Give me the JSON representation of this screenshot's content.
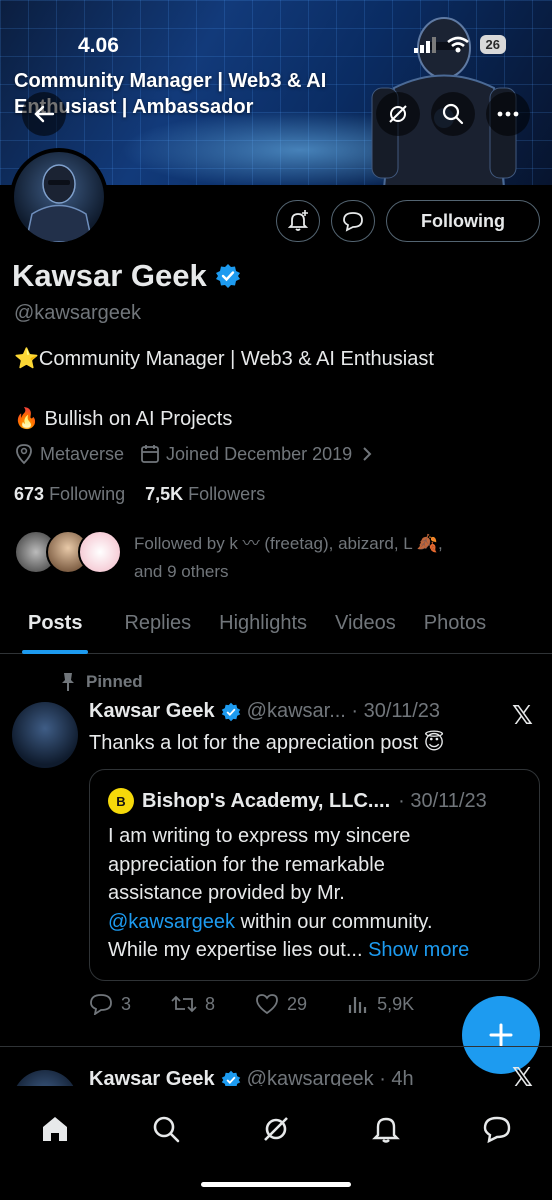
{
  "status_bar": {
    "time": "4.06",
    "battery": "26"
  },
  "banner": {
    "line1": "Community Manager | Web3 & AI",
    "line2": "Enthusiast | Ambassador"
  },
  "profile": {
    "name": "Kawsar Geek",
    "handle": "@kawsargeek",
    "bio_line1": "⭐Community Manager | Web3 & AI Enthusiast",
    "bio_line2": "🔥 Bullish on AI Projects",
    "location": "Metaverse",
    "joined": "Joined December 2019",
    "following_count": "673",
    "following_label": "Following",
    "followers_count": "7,5K",
    "followers_label": "Followers",
    "followed_by_line1": "Followed by k 〰 (freetag), abizard, L 🍂,",
    "followed_by_line2": "and 9 others",
    "follow_button": "Following"
  },
  "tabs": [
    "Posts",
    "Replies",
    "Highlights",
    "Videos",
    "Photos"
  ],
  "pinned_post": {
    "pinned_label": "Pinned",
    "author": "Kawsar Geek",
    "handle_date": "@kawsar... · 30/11/23",
    "text": "Thanks a lot for the appreciation post 😇",
    "quote": {
      "author": "Bishop's Academy, LLC....",
      "date": "· 30/11/23",
      "avatar_letter": "B",
      "text_line1": "I am writing to express my sincere",
      "text_line2": "appreciation for the remarkable",
      "text_line3": "assistance provided by Mr.",
      "mention": "@kawsargeek",
      "text_line4_rest": " within our community.",
      "text_line5": "While my expertise lies out...",
      "show_more": "Show more"
    },
    "stats": {
      "replies": "3",
      "reposts": "8",
      "likes": "29",
      "views": "5,9K"
    }
  },
  "next_post": {
    "author": "Kawsar Geek",
    "handle_date": "@kawsargeek · 4h"
  },
  "colors": {
    "accent": "#1d9bf0",
    "verified": "#1d9bf0",
    "muted": "#71767b"
  }
}
